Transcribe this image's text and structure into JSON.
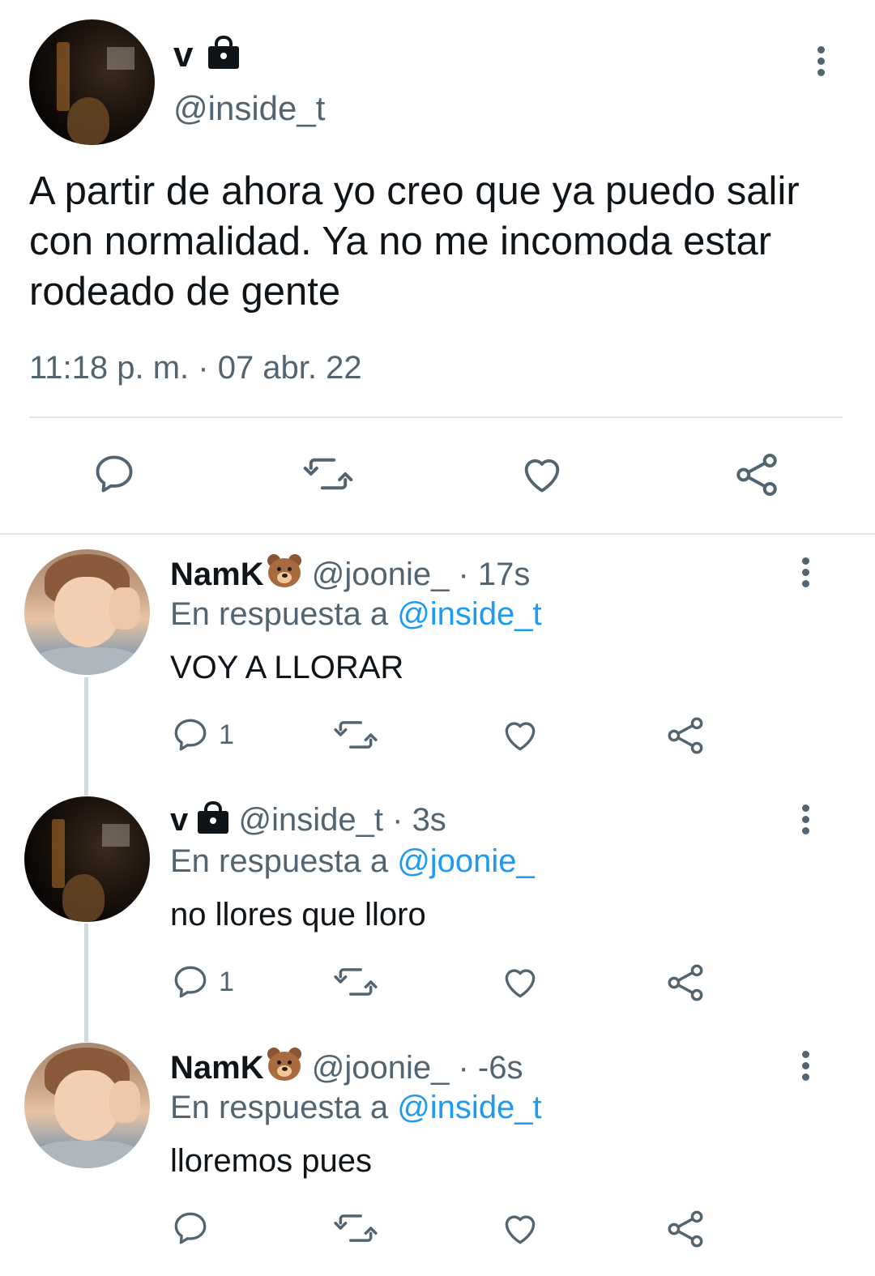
{
  "main_tweet": {
    "author_name": "v",
    "author_handle": "@inside_t",
    "text": "A partir de ahora yo creo que ya puedo salir con normalidad. Ya no me incomoda estar rodeado de gente",
    "timestamp": "11:18 p. m. · 07 abr. 22",
    "protected": true
  },
  "replies": [
    {
      "author_name": "NamK",
      "author_emoji": "bear-icon",
      "author_handle": "@joonie_",
      "time": "17s",
      "reply_prefix": "En respuesta a",
      "reply_to": "@inside_t",
      "text": "VOY A LLORAR",
      "reply_count": "1"
    },
    {
      "author_name": "v",
      "author_emoji": "lock-icon",
      "author_handle": "@inside_t",
      "time": "3s",
      "reply_prefix": "En respuesta a",
      "reply_to": "@joonie_",
      "text": "no llores que lloro",
      "reply_count": "1"
    },
    {
      "author_name": "NamK",
      "author_emoji": "bear-icon",
      "author_handle": "@joonie_",
      "time": "-6s",
      "reply_prefix": "En respuesta a",
      "reply_to": "@inside_t",
      "text": "lloremos pues",
      "reply_count": ""
    }
  ],
  "separator": "·",
  "colors": {
    "text": "#0f1419",
    "secondary": "#536471",
    "accent": "#1d9bf0",
    "divider": "#e1e6ea",
    "thread_line": "#cfd9de"
  }
}
